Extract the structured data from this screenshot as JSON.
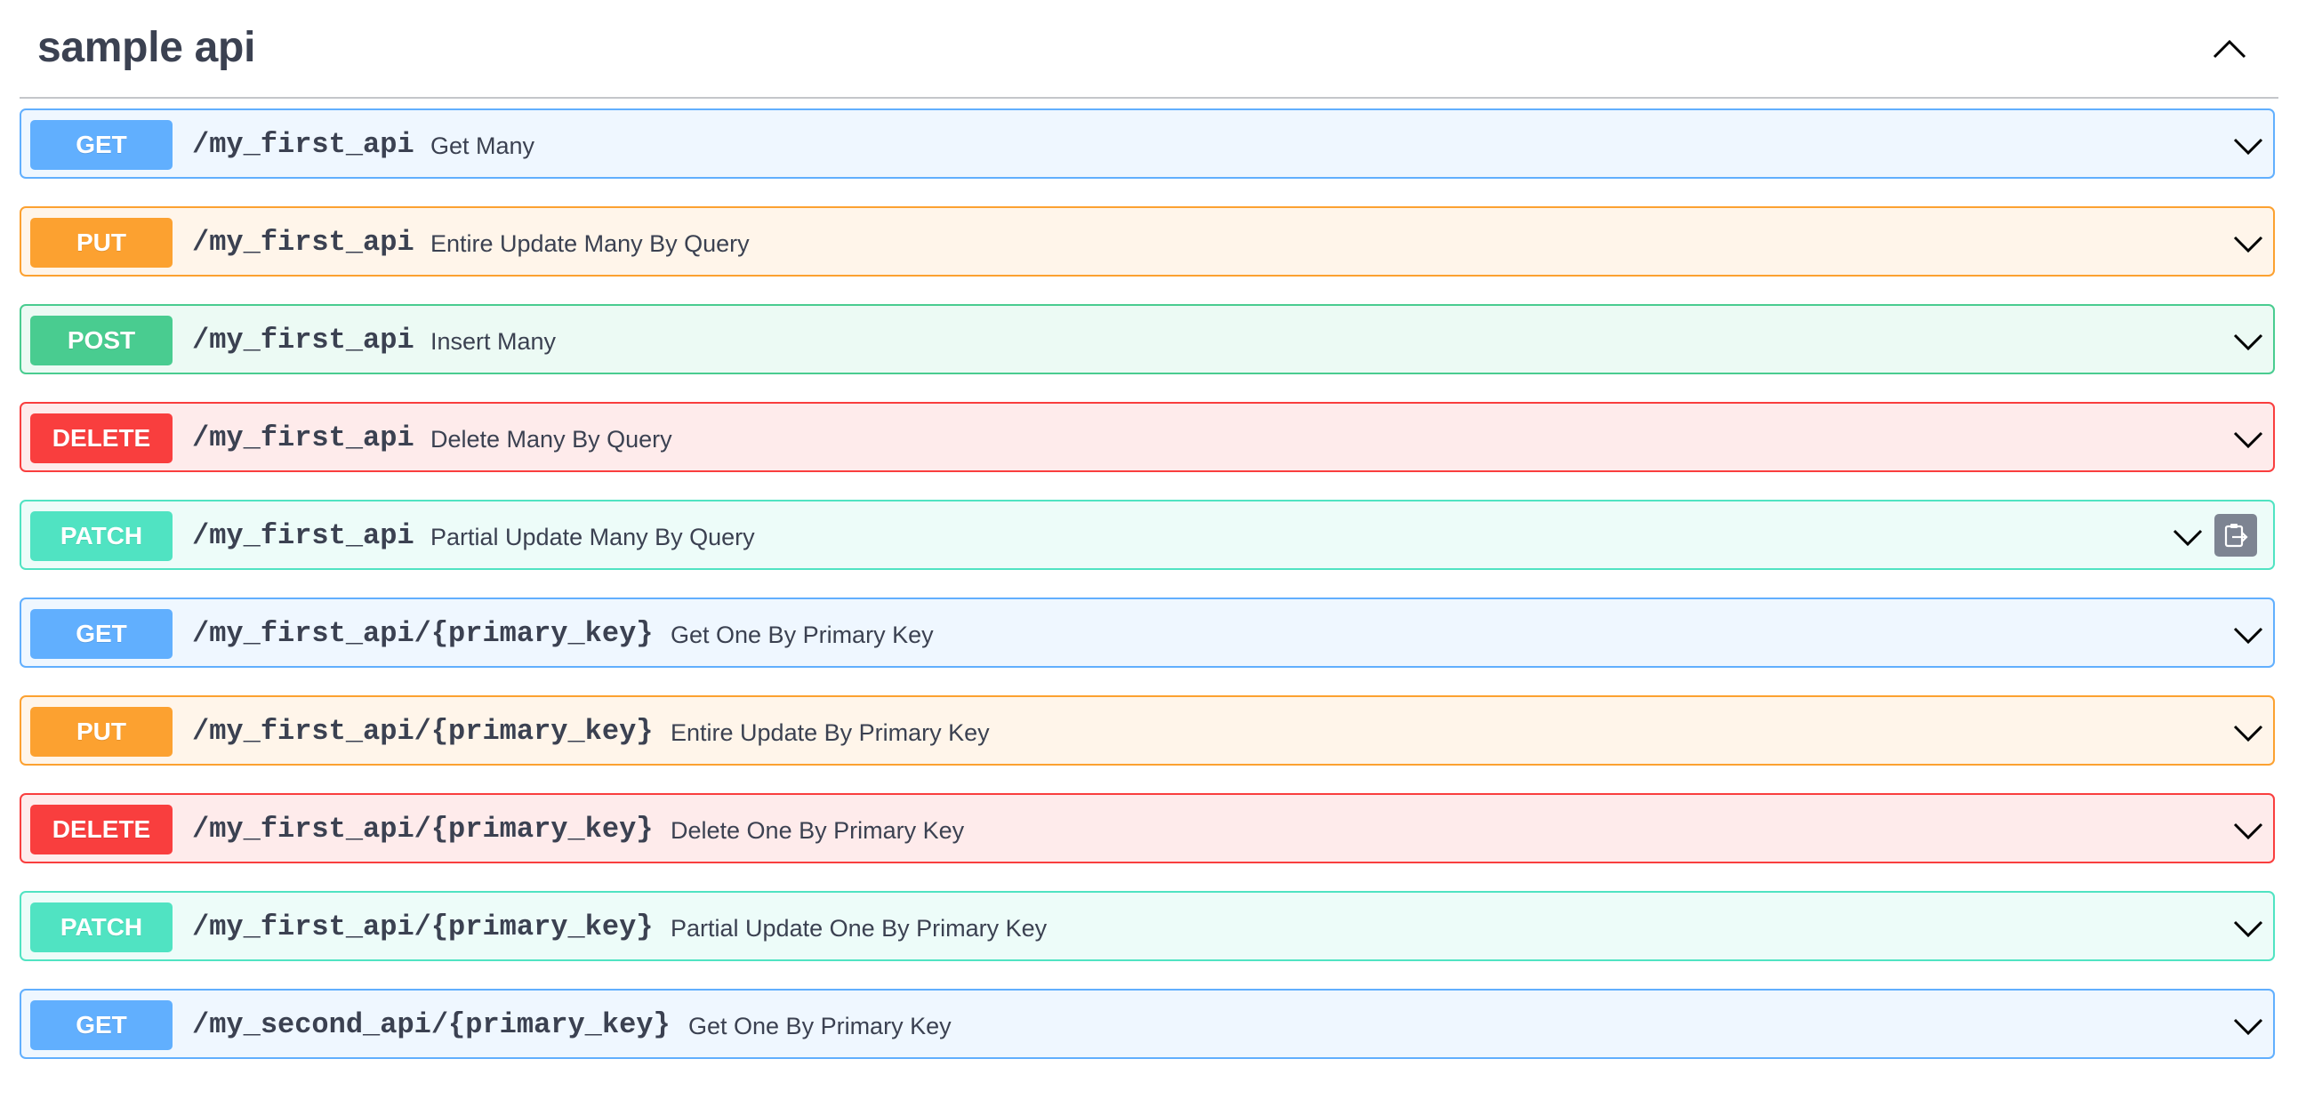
{
  "section": {
    "title": "sample api",
    "collapse_icon": "chevron-up-icon"
  },
  "colors": {
    "get": "#61affe",
    "put": "#fca130",
    "post": "#49cc90",
    "delete": "#f93e3e",
    "patch": "#50e3c2",
    "text": "#3b4151"
  },
  "operations": [
    {
      "method": "GET",
      "path": "/my_first_api",
      "summary": "Get Many"
    },
    {
      "method": "PUT",
      "path": "/my_first_api",
      "summary": "Entire Update Many By Query"
    },
    {
      "method": "POST",
      "path": "/my_first_api",
      "summary": "Insert Many"
    },
    {
      "method": "DELETE",
      "path": "/my_first_api",
      "summary": "Delete Many By Query"
    },
    {
      "method": "PATCH",
      "path": "/my_first_api",
      "summary": "Partial Update Many By Query"
    },
    {
      "method": "GET",
      "path": "/my_first_api/{primary_key}",
      "summary": "Get One By Primary Key"
    },
    {
      "method": "PUT",
      "path": "/my_first_api/{primary_key}",
      "summary": "Entire Update By Primary Key"
    },
    {
      "method": "DELETE",
      "path": "/my_first_api/{primary_key}",
      "summary": "Delete One By Primary Key"
    },
    {
      "method": "PATCH",
      "path": "/my_first_api/{primary_key}",
      "summary": "Partial Update One By Primary Key"
    },
    {
      "method": "GET",
      "path": "/my_second_api/{primary_key}",
      "summary": "Get One By Primary Key"
    }
  ]
}
